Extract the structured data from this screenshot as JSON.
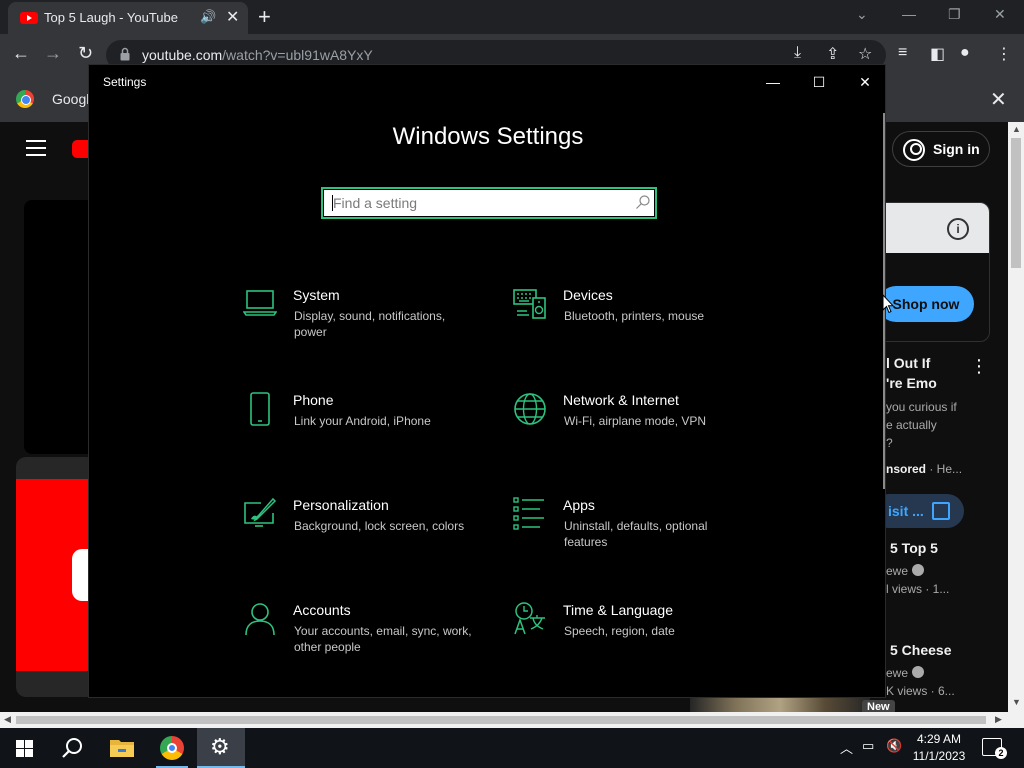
{
  "browser": {
    "tab_title": "Top 5 Laugh - YouTube",
    "url_host": "youtube.com",
    "url_path": "/watch?v=ubl91wA8YxY",
    "bookmark_label": "Googl"
  },
  "youtube": {
    "sign_in": "Sign in",
    "shop_now": "Shop now",
    "ad_title_line1": "l Out If",
    "ad_title_line2": "'re Emo",
    "ad_body_line1": "you curious if",
    "ad_body_line2": "e actually",
    "ad_body_line3": "?",
    "sponsored": "nsored",
    "sponsored_tail": " · He...",
    "visit": "isit ...",
    "video1_title": "5 Top 5",
    "video1_channel": "ewe",
    "video1_meta": "l views · 1...",
    "video2_title": "5 Cheese",
    "video2_channel": "ewe",
    "video2_meta": "K views · 6...",
    "new_badge": "New"
  },
  "settings": {
    "window_title": "Settings",
    "heading": "Windows Settings",
    "search_placeholder": "Find a setting",
    "accent_color": "#2ec27e",
    "tiles": [
      {
        "name": "System",
        "desc": "Display, sound, notifications, power",
        "icon": "laptop-icon"
      },
      {
        "name": "Devices",
        "desc": "Bluetooth, printers, mouse",
        "icon": "devices-icon"
      },
      {
        "name": "Phone",
        "desc": "Link your Android, iPhone",
        "icon": "phone-icon"
      },
      {
        "name": "Network & Internet",
        "desc": "Wi-Fi, airplane mode, VPN",
        "icon": "globe-icon"
      },
      {
        "name": "Personalization",
        "desc": "Background, lock screen, colors",
        "icon": "paint-icon"
      },
      {
        "name": "Apps",
        "desc": "Uninstall, defaults, optional features",
        "icon": "apps-list-icon"
      },
      {
        "name": "Accounts",
        "desc": "Your accounts, email, sync, work, other people",
        "icon": "person-icon"
      },
      {
        "name": "Time & Language",
        "desc": "Speech, region, date",
        "icon": "time-language-icon"
      }
    ]
  },
  "taskbar": {
    "time": "4:29 AM",
    "date": "11/1/2023",
    "notification_count": "2"
  }
}
